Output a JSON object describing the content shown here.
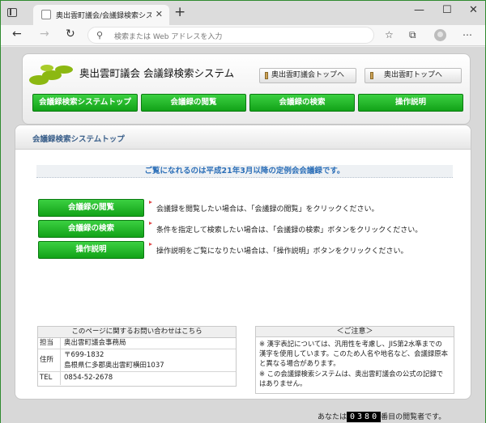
{
  "browser": {
    "tab_title": "奥出雲町議会/会議録検索システム",
    "tab_close": "✕",
    "new_tab": "+",
    "address_placeholder": "検索または Web アドレスを入力",
    "window_controls": [
      "—",
      "☐",
      "✕"
    ]
  },
  "header": {
    "site_title": "奥出雲町議会 会議録検索システム",
    "top_links": [
      "奥出雲町議会トップへ",
      "奥出雲町トップへ"
    ],
    "nav": [
      "会議録検索システムトップ",
      "会議録の閲覧",
      "会議録の検索",
      "操作説明"
    ]
  },
  "main": {
    "section_title": "会議録検索システムトップ",
    "notice": "ご覧になれるのは平成21年3月以降の定例会会議録です。",
    "actions": [
      {
        "label": "会議録の閲覧",
        "desc": "会議録を閲覧したい場合は、「会議録の閲覧」をクリックください。"
      },
      {
        "label": "会議録の検索",
        "desc": "条件を指定して検索したい場合は、「会議録の検索」ボタンをクリックください。"
      },
      {
        "label": "操作説明",
        "desc": "操作説明をご覧になりたい場合は、「操作説明」ボタンをクリックください。"
      }
    ],
    "contact": {
      "title": "このページに関するお問い合わせはこちら",
      "rows": [
        {
          "label": "担当",
          "lines": [
            "奥出雲町議会事務局"
          ]
        },
        {
          "label": "住所",
          "lines": [
            "〒699-1832",
            "島根県仁多郡奥出雲町横田1037"
          ]
        },
        {
          "label": "TEL",
          "lines": [
            "0854-52-2678"
          ]
        }
      ]
    },
    "caution": {
      "title": "＜ご注意＞",
      "lines": [
        "※ 漢字表記については、汎用性を考慮し、JIS第2水準までの",
        "漢字を使用しています。このため人名や地名など、会議録原本",
        "と異なる場合があります。",
        "※ この会議録検索システムは、奥出雲町議会の公式の記録で",
        "はありません。"
      ]
    },
    "counter": {
      "prefix": "あなたは",
      "digits": "0380",
      "suffix": "番目の閲覧者です。"
    }
  },
  "colors": {
    "accent_green": "#12a218",
    "notice_blue": "#2c6fb8",
    "frame_green": "#3c9a3c"
  }
}
